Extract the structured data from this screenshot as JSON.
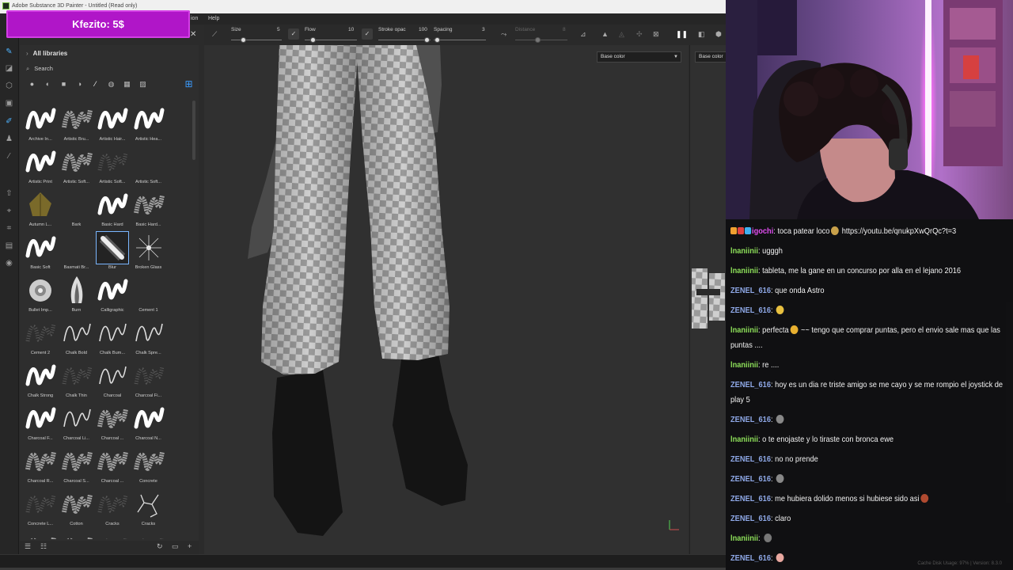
{
  "app": {
    "title": "Adobe Substance 3D Painter - Untitled (Read only)",
    "menu": [
      "ion",
      "Help"
    ]
  },
  "donation": {
    "text": "Kfezito: 5$",
    "color": "#b016c8"
  },
  "shelf": {
    "library_label": "All libraries",
    "search_placeholder": "Search",
    "brushes": [
      {
        "label": "Archive In...",
        "style": "stroke"
      },
      {
        "label": "Artistic Bru...",
        "style": "soft"
      },
      {
        "label": "Artistic Hair...",
        "style": "stroke"
      },
      {
        "label": "Artistic Hea...",
        "style": "stroke"
      },
      {
        "label": "Artistic Print",
        "style": "stroke"
      },
      {
        "label": "Artistic Soft...",
        "style": "soft"
      },
      {
        "label": "Artistic Soft...",
        "style": "faint"
      },
      {
        "label": "Artistic Soft...",
        "style": "none"
      },
      {
        "label": "Autumn L...",
        "style": "leaf"
      },
      {
        "label": "Bark",
        "style": "none"
      },
      {
        "label": "Basic Hard",
        "style": "stroke"
      },
      {
        "label": "Basic Hard...",
        "style": "soft"
      },
      {
        "label": "Basic Soft",
        "style": "stroke"
      },
      {
        "label": "Basmati Br...",
        "style": "none"
      },
      {
        "label": "Blur",
        "style": "blur"
      },
      {
        "label": "Broken Glass",
        "style": "star"
      },
      {
        "label": "Bullet Imp...",
        "style": "gear"
      },
      {
        "label": "Burn",
        "style": "burn"
      },
      {
        "label": "Calligraphic",
        "style": "stroke"
      },
      {
        "label": "Cement 1",
        "style": "none"
      },
      {
        "label": "Cement 2",
        "style": "faint"
      },
      {
        "label": "Chalk Bold",
        "style": "thin"
      },
      {
        "label": "Chalk Bum...",
        "style": "thin"
      },
      {
        "label": "Chalk Spre...",
        "style": "thin"
      },
      {
        "label": "Chalk Strong",
        "style": "stroke"
      },
      {
        "label": "Chalk Thin",
        "style": "faint"
      },
      {
        "label": "Charcoal",
        "style": "thin"
      },
      {
        "label": "Charcoal Fi...",
        "style": "faint"
      },
      {
        "label": "Charcoal F...",
        "style": "stroke"
      },
      {
        "label": "Charcoal Li...",
        "style": "thin"
      },
      {
        "label": "Charcoal ...",
        "style": "soft"
      },
      {
        "label": "Charcoal N...",
        "style": "stroke"
      },
      {
        "label": "Charcoal R...",
        "style": "soft"
      },
      {
        "label": "Charcoal S...",
        "style": "soft"
      },
      {
        "label": "Charcoal ...",
        "style": "soft"
      },
      {
        "label": "Concrete",
        "style": "soft"
      },
      {
        "label": "Concrete L...",
        "style": "faint"
      },
      {
        "label": "Cotton",
        "style": "soft"
      },
      {
        "label": "Cracks",
        "style": "faint"
      },
      {
        "label": "Cracks",
        "style": "cracks"
      },
      {
        "label": "",
        "style": "soft"
      },
      {
        "label": "",
        "style": "soft"
      },
      {
        "label": "",
        "style": "faint"
      },
      {
        "label": "",
        "style": "faint"
      }
    ]
  },
  "tool_properties": {
    "size_label": "Size",
    "size_value": "5",
    "flow_label": "Flow",
    "flow_value": "10",
    "stroke_label": "Stroke opac",
    "stroke_value": "100",
    "spacing_label": "Spacing",
    "spacing_value": "3",
    "distance_label": "Distance",
    "distance_value": "8"
  },
  "viewport": {
    "channel_dropdown": "Base color",
    "uv_channel_dropdown": "Base color"
  },
  "status": {
    "cache_text": "Cache Disk Usage: 97% | Version: 8.3.0"
  },
  "chat": {
    "messages": [
      {
        "user": "igochi",
        "text": "toca patear loco",
        "extra": "https://youtu.be/qnukpXwQrQc?t=3",
        "color": "#e04ef0",
        "badges": true,
        "emote": "#c9a14a"
      },
      {
        "user": "lnaniinii",
        "text": "ugggh",
        "color": "#8ee05a"
      },
      {
        "user": "lnaniinii",
        "text": "tableta, me la gane en un concurso por alla en el lejano 2016",
        "color": "#8ee05a"
      },
      {
        "user": "ZENEL_616",
        "text": "que onda Astro",
        "color": "#8fa9e8"
      },
      {
        "user": "ZENEL_616",
        "text": "",
        "color": "#8fa9e8",
        "emote": "#e8c040"
      },
      {
        "user": "lnaniinii",
        "text": "perfecta",
        "extra": "~~ tengo que comprar puntas, pero el envio sale mas que las puntas ....",
        "color": "#8ee05a",
        "emote": "#e8b030"
      },
      {
        "user": "lnaniinii",
        "text": "re ....",
        "color": "#8ee05a"
      },
      {
        "user": "ZENEL_616",
        "text": "hoy es un dia re triste amigo se me cayo y se me rompio el joystick de play 5",
        "color": "#8fa9e8"
      },
      {
        "user": "ZENEL_616",
        "text": "",
        "color": "#8fa9e8",
        "emote": "#888"
      },
      {
        "user": "lnaniinii",
        "text": "o te enojaste y lo tiraste con bronca ewe",
        "color": "#8ee05a"
      },
      {
        "user": "ZENEL_616",
        "text": "no no prende",
        "color": "#8fa9e8"
      },
      {
        "user": "ZENEL_616",
        "text": "",
        "color": "#8fa9e8",
        "emote": "#888"
      },
      {
        "user": "ZENEL_616",
        "text": "me hubiera dolido menos si hubiese sido asi",
        "color": "#8fa9e8",
        "emote": "#b04a30"
      },
      {
        "user": "ZENEL_616",
        "text": "claro",
        "color": "#8fa9e8"
      },
      {
        "user": "lnaniinii",
        "text": "",
        "color": "#8ee05a",
        "emote": "#777"
      },
      {
        "user": "ZENEL_616",
        "text": "",
        "color": "#8fa9e8",
        "emote": "#e9a8a0"
      }
    ]
  }
}
